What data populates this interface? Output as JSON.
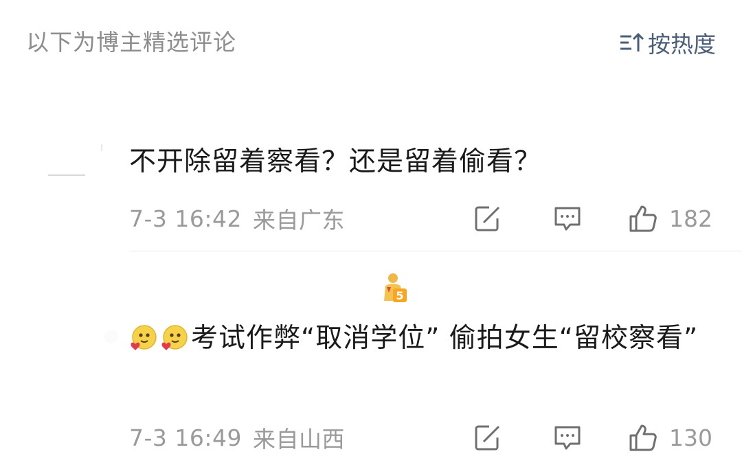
{
  "header": {
    "title": "以下为博主精选评论",
    "sort_label": "按热度"
  },
  "comments": [
    {
      "text": "不开除留着察看？还是留着偷看？",
      "time": "7-3 16:42",
      "location": "来自广东",
      "likes": "182"
    },
    {
      "text": "考试作弊“取消学位” 偷拍女生“留校察看”",
      "time": "7-3 16:49",
      "location": "来自山西",
      "likes": "130"
    }
  ],
  "colors": {
    "header_text": "#8d8d8d",
    "sort_accent": "#4a5e78",
    "meta_text": "#9a9a9a",
    "divider": "#e6e6e6"
  },
  "icons": [
    "sort-icon",
    "repost-icon",
    "comment-icon",
    "like-icon",
    "emoji-icon",
    "vip-badge-icon"
  ]
}
